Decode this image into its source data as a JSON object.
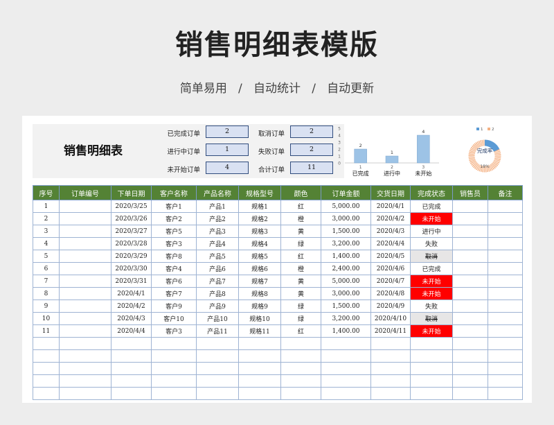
{
  "header": {
    "title": "销售明细表模版",
    "subtitle": "简单易用   /   自动统计   /   自动更新"
  },
  "summary": {
    "title": "销售明细表",
    "items": [
      {
        "label": "已完成订单",
        "value": "2"
      },
      {
        "label": "进行中订单",
        "value": "1"
      },
      {
        "label": "未开始订单",
        "value": "4"
      },
      {
        "label": "取消订单",
        "value": "2"
      },
      {
        "label": "失败订单",
        "value": "2"
      },
      {
        "label": "合计订单",
        "value": "11"
      }
    ]
  },
  "chart_data": [
    {
      "type": "bar",
      "categories": [
        "已完成",
        "进行中",
        "未开始"
      ],
      "x_ticks": [
        "1",
        "2",
        "3"
      ],
      "values": [
        2,
        1,
        4
      ],
      "ylim": [
        0,
        5
      ],
      "y_ticks": [
        "0",
        "1",
        "2",
        "3",
        "4",
        "5"
      ],
      "color": "#9dc3e6"
    },
    {
      "type": "pie",
      "style": "donut",
      "legend": [
        "1",
        "2"
      ],
      "legend_position": "top",
      "values": [
        18,
        82
      ],
      "colors": [
        "#5b9bd5",
        "#f4b183"
      ],
      "center_label": "完成率",
      "slice_label": "18%"
    }
  ],
  "table": {
    "columns": [
      "序号",
      "订单编号",
      "下单日期",
      "客户名称",
      "产品名称",
      "规格型号",
      "颜色",
      "订单金额",
      "交货日期",
      "完成状态",
      "销售员",
      "备注"
    ],
    "rows": [
      {
        "no": "1",
        "order_id": "",
        "order_date": "2020/3/25",
        "customer": "客户1",
        "product": "产品1",
        "spec": "规格1",
        "color": "红",
        "amount": "5,000.00",
        "delivery": "2020/4/1",
        "status": "已完成",
        "status_style": "normal",
        "salesperson": "",
        "remark": ""
      },
      {
        "no": "2",
        "order_id": "",
        "order_date": "2020/3/26",
        "customer": "客户2",
        "product": "产品2",
        "spec": "规格2",
        "color": "橙",
        "amount": "3,000.00",
        "delivery": "2020/4/2",
        "status": "未开始",
        "status_style": "red",
        "salesperson": "",
        "remark": ""
      },
      {
        "no": "3",
        "order_id": "",
        "order_date": "2020/3/27",
        "customer": "客户5",
        "product": "产品3",
        "spec": "规格3",
        "color": "黄",
        "amount": "1,500.00",
        "delivery": "2020/4/3",
        "status": "进行中",
        "status_style": "normal",
        "salesperson": "",
        "remark": ""
      },
      {
        "no": "4",
        "order_id": "",
        "order_date": "2020/3/28",
        "customer": "客户3",
        "product": "产品4",
        "spec": "规格4",
        "color": "绿",
        "amount": "3,200.00",
        "delivery": "2020/4/4",
        "status": "失败",
        "status_style": "normal",
        "salesperson": "",
        "remark": ""
      },
      {
        "no": "5",
        "order_id": "",
        "order_date": "2020/3/29",
        "customer": "客户8",
        "product": "产品5",
        "spec": "规格5",
        "color": "红",
        "amount": "1,400.00",
        "delivery": "2020/4/5",
        "status": "取消",
        "status_style": "strike",
        "salesperson": "",
        "remark": ""
      },
      {
        "no": "6",
        "order_id": "",
        "order_date": "2020/3/30",
        "customer": "客户4",
        "product": "产品6",
        "spec": "规格6",
        "color": "橙",
        "amount": "2,400.00",
        "delivery": "2020/4/6",
        "status": "已完成",
        "status_style": "normal",
        "salesperson": "",
        "remark": ""
      },
      {
        "no": "7",
        "order_id": "",
        "order_date": "2020/3/31",
        "customer": "客户6",
        "product": "产品7",
        "spec": "规格7",
        "color": "黄",
        "amount": "5,000.00",
        "delivery": "2020/4/7",
        "status": "未开始",
        "status_style": "red",
        "salesperson": "",
        "remark": ""
      },
      {
        "no": "8",
        "order_id": "",
        "order_date": "2020/4/1",
        "customer": "客户7",
        "product": "产品8",
        "spec": "规格8",
        "color": "黄",
        "amount": "3,000.00",
        "delivery": "2020/4/8",
        "status": "未开始",
        "status_style": "red",
        "salesperson": "",
        "remark": ""
      },
      {
        "no": "9",
        "order_id": "",
        "order_date": "2020/4/2",
        "customer": "客户9",
        "product": "产品9",
        "spec": "规格9",
        "color": "绿",
        "amount": "1,500.00",
        "delivery": "2020/4/9",
        "status": "失败",
        "status_style": "normal",
        "salesperson": "",
        "remark": ""
      },
      {
        "no": "10",
        "order_id": "",
        "order_date": "2020/4/3",
        "customer": "客户10",
        "product": "产品10",
        "spec": "规格10",
        "color": "绿",
        "amount": "3,200.00",
        "delivery": "2020/4/10",
        "status": "取消",
        "status_style": "strike",
        "salesperson": "",
        "remark": ""
      },
      {
        "no": "11",
        "order_id": "",
        "order_date": "2020/4/4",
        "customer": "客户3",
        "product": "产品11",
        "spec": "规格11",
        "color": "红",
        "amount": "1,400.00",
        "delivery": "2020/4/11",
        "status": "未开始",
        "status_style": "red",
        "salesperson": "",
        "remark": ""
      }
    ],
    "empty_rows": 5,
    "header_color": "#548235"
  }
}
